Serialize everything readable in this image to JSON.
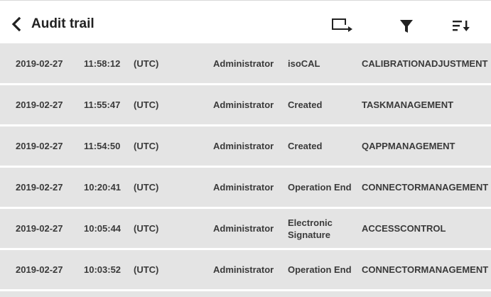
{
  "header": {
    "title": "Audit trail",
    "icons": [
      "back-chevron-icon",
      "export-icon",
      "filter-icon",
      "sort-icon"
    ]
  },
  "colors": {
    "row_background": "#e4e4e4",
    "header_background": "#ffffff",
    "text": "#3a3a3a"
  },
  "rows": [
    {
      "date": "2019-02-27",
      "time": "11:58:12",
      "timezone": "(UTC)",
      "user": "Administrator",
      "action": "isoCAL",
      "module": "CALIBRATIONADJUSTMENT"
    },
    {
      "date": "2019-02-27",
      "time": "11:55:47",
      "timezone": "(UTC)",
      "user": "Administrator",
      "action": "Created",
      "module": "TASKMANAGEMENT"
    },
    {
      "date": "2019-02-27",
      "time": "11:54:50",
      "timezone": "(UTC)",
      "user": "Administrator",
      "action": "Created",
      "module": "QAPPMANAGEMENT"
    },
    {
      "date": "2019-02-27",
      "time": "10:20:41",
      "timezone": "(UTC)",
      "user": "Administrator",
      "action": "Operation End",
      "module": "CONNECTORMANAGEMENT"
    },
    {
      "date": "2019-02-27",
      "time": "10:05:44",
      "timezone": "(UTC)",
      "user": "Administrator",
      "action": "Electronic Signature",
      "module": "ACCESSCONTROL"
    },
    {
      "date": "2019-02-27",
      "time": "10:03:52",
      "timezone": "(UTC)",
      "user": "Administrator",
      "action": "Operation End",
      "module": "CONNECTORMANAGEMENT"
    }
  ]
}
